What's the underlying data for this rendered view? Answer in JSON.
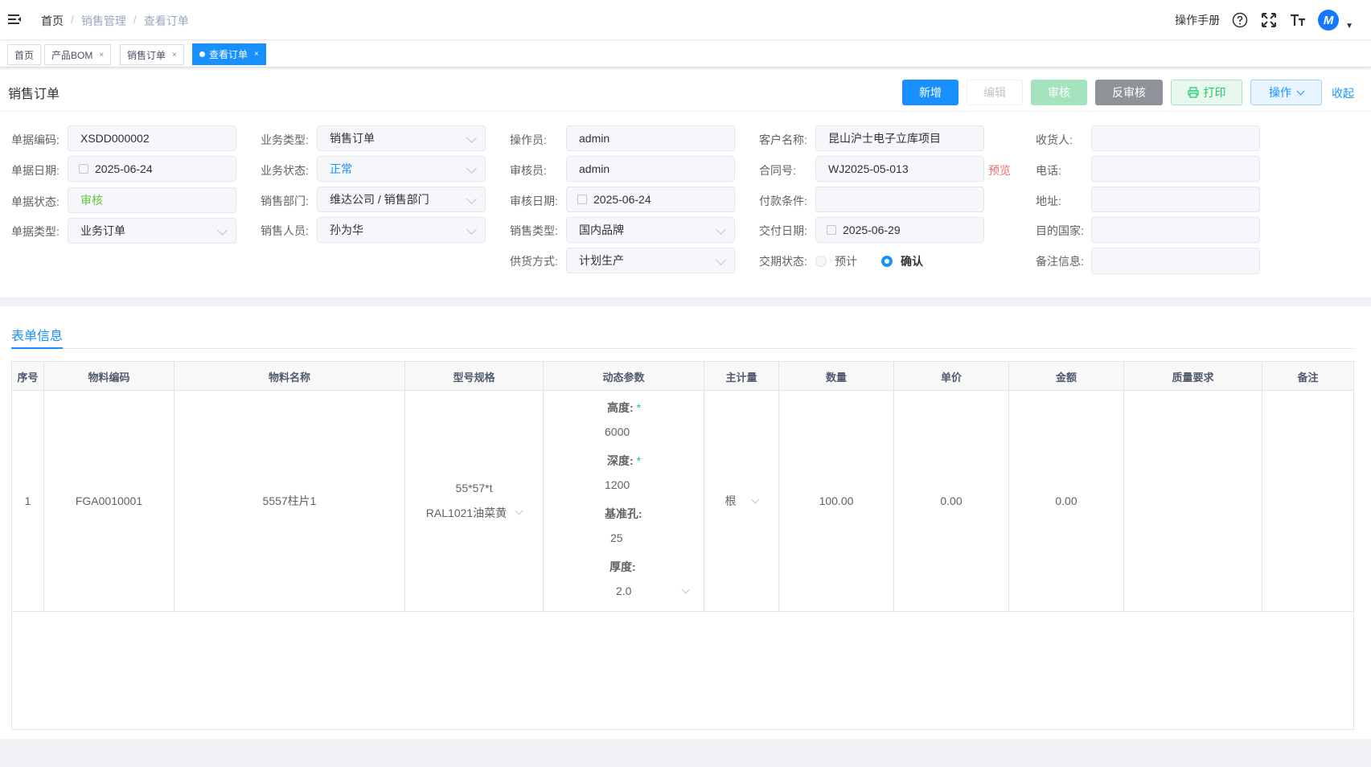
{
  "navbar": {
    "breadcrumb": [
      "首页",
      "销售管理",
      "查看订单"
    ],
    "breadcrumb_sep": "/",
    "manual": "操作手册",
    "avatar_text": "M"
  },
  "tabs": [
    {
      "label": "首页",
      "closable": false,
      "active": false
    },
    {
      "label": "产品BOM",
      "closable": true,
      "active": false
    },
    {
      "label": "销售订单",
      "closable": true,
      "active": false
    },
    {
      "label": "查看订单",
      "closable": true,
      "active": true
    }
  ],
  "close_glyph": "×",
  "header": {
    "title": "销售订单",
    "buttons": {
      "add": "新增",
      "edit": "编辑",
      "audit": "审核",
      "unaudit": "反审核",
      "print": "打印",
      "operate": "操作",
      "collapse": "收起"
    }
  },
  "form": {
    "doc_no": {
      "label": "单据编码:",
      "value": "XSDD000002"
    },
    "doc_date": {
      "label": "单据日期:",
      "value": "2025-06-24"
    },
    "doc_status": {
      "label": "单据状态:",
      "value": "审核"
    },
    "doc_type": {
      "label": "单据类型:",
      "value": "业务订单"
    },
    "biz_type": {
      "label": "业务类型:",
      "value": "销售订单"
    },
    "biz_status": {
      "label": "业务状态:",
      "value": "正常"
    },
    "sales_dept": {
      "label": "销售部门:",
      "value": "维达公司 / 销售部门"
    },
    "sales_person": {
      "label": "销售人员:",
      "value": "孙为华"
    },
    "operator": {
      "label": "操作员:",
      "value": "admin"
    },
    "auditor": {
      "label": "审核员:",
      "value": "admin"
    },
    "audit_date": {
      "label": "审核日期:",
      "value": "2025-06-24"
    },
    "sales_type": {
      "label": "销售类型:",
      "value": "国内品牌"
    },
    "supply_mode": {
      "label": "供货方式:",
      "value": "计划生产"
    },
    "customer": {
      "label": "客户名称:",
      "value": "昆山沪士电子立库项目"
    },
    "contract_no": {
      "label": "合同号:",
      "value": "WJ2025-05-013",
      "preview": "预览"
    },
    "payment_terms": {
      "label": "付款条件:",
      "value": ""
    },
    "delivery_date": {
      "label": "交付日期:",
      "value": "2025-06-29"
    },
    "delivery_status": {
      "label": "交期状态:",
      "options": [
        "预计",
        "确认"
      ],
      "selected": "确认"
    },
    "receiver": {
      "label": "收货人:",
      "value": ""
    },
    "phone": {
      "label": "电话:",
      "value": ""
    },
    "address": {
      "label": "地址:",
      "value": ""
    },
    "dest_country": {
      "label": "目的国家:",
      "value": ""
    },
    "remark": {
      "label": "备注信息:",
      "value": ""
    }
  },
  "section": {
    "tab": "表单信息"
  },
  "table": {
    "columns": [
      "序号",
      "物料编码",
      "物料名称",
      "型号规格",
      "动态参数",
      "主计量",
      "数量",
      "单价",
      "金额",
      "质量要求",
      "备注"
    ],
    "rows": [
      {
        "index": "1",
        "code": "FGA0010001",
        "name": "5557柱片1",
        "spec": "55*57*t",
        "color": "RAL1021油菜黄",
        "params": [
          {
            "label": "高度:",
            "required": true,
            "value": "6000"
          },
          {
            "label": "深度:",
            "required": true,
            "value": "1200"
          },
          {
            "label": "基准孔:",
            "required": false,
            "value": "25"
          },
          {
            "label": "厚度:",
            "required": false,
            "value": "2.0"
          }
        ],
        "unit": "根",
        "qty": "100.00",
        "price": "0.00",
        "amount": "0.00",
        "quality": "",
        "note": ""
      }
    ]
  }
}
